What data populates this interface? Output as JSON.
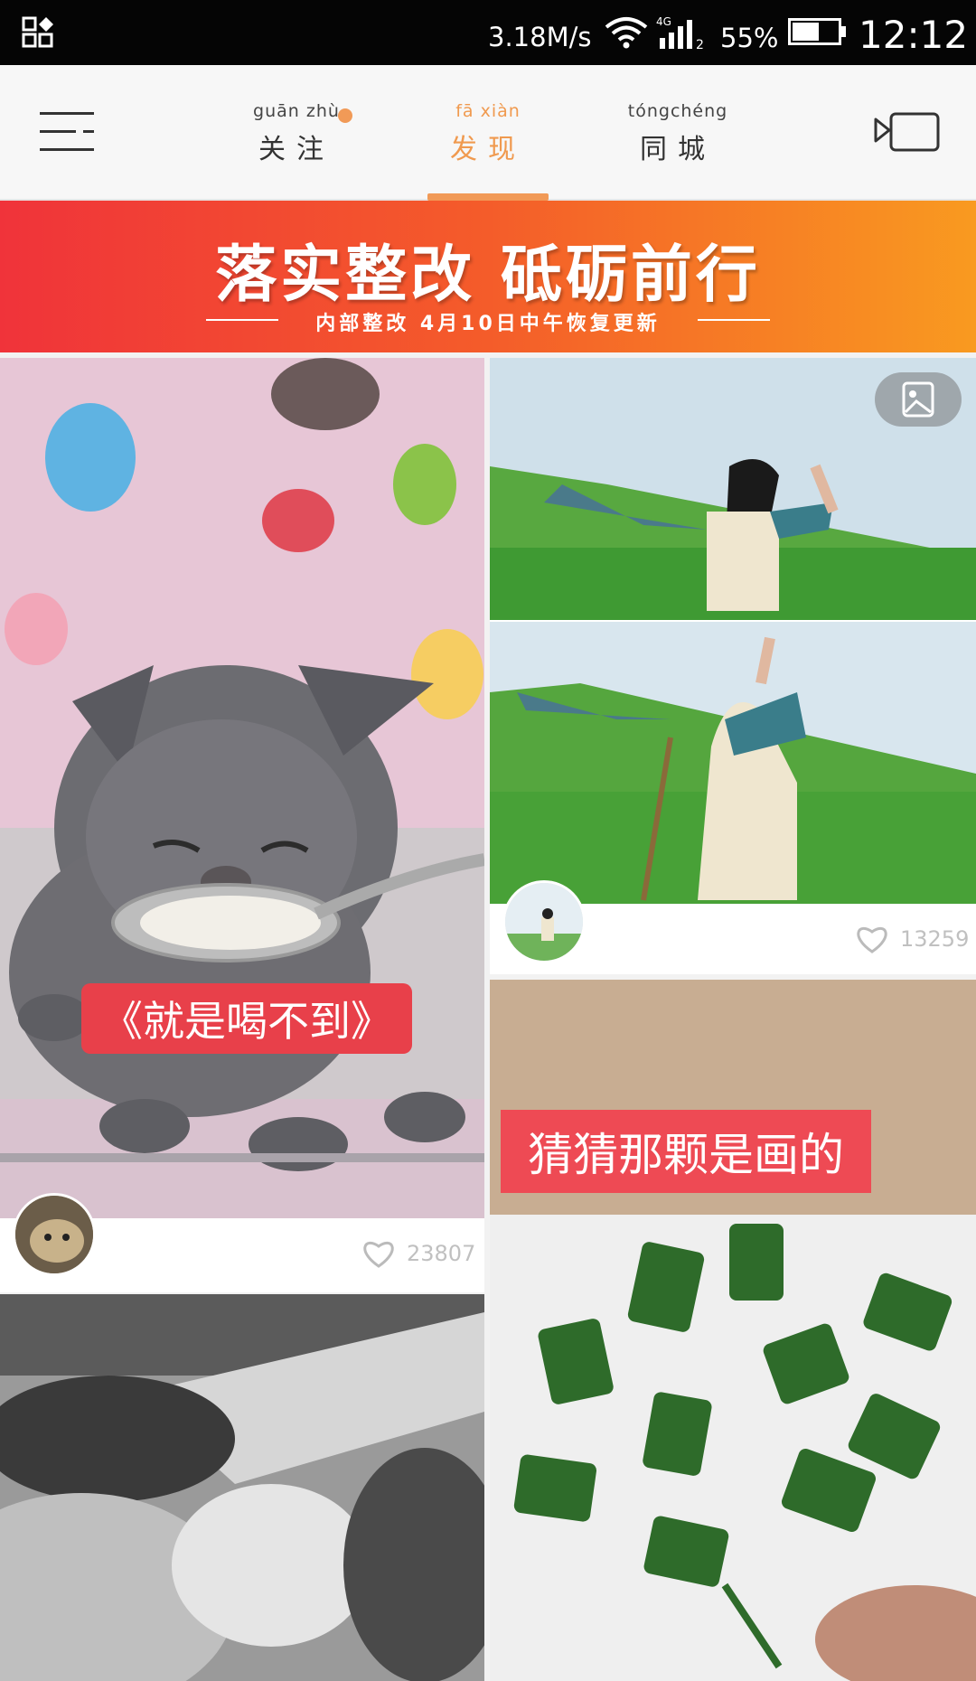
{
  "status_bar": {
    "speed": "3.18M/s",
    "network": "4G",
    "battery": "55%",
    "time": "12:12"
  },
  "nav": {
    "tabs": [
      {
        "pinyin": "guān zhù",
        "label": "关注"
      },
      {
        "pinyin": "fā  xiàn",
        "label": "发现"
      },
      {
        "pinyin": "tóngchéng",
        "label": "同城"
      }
    ],
    "active_color": "#f19a57"
  },
  "banner": {
    "title": "落实整改  砥砺前行",
    "subtitle": "内部整改 4月10日中午恢复更新"
  },
  "feed": {
    "left": [
      {
        "caption": "《就是喝不到》",
        "likes": "23807"
      },
      {
        "caption": "",
        "likes": ""
      }
    ],
    "right": [
      {
        "caption": "",
        "likes": "13259"
      },
      {
        "caption": "猜猜那颗是画的",
        "likes": ""
      }
    ]
  },
  "colors": {
    "banner_start": "#f0333a",
    "banner_end": "#f99a20",
    "caption_bg": "#e8404a"
  }
}
